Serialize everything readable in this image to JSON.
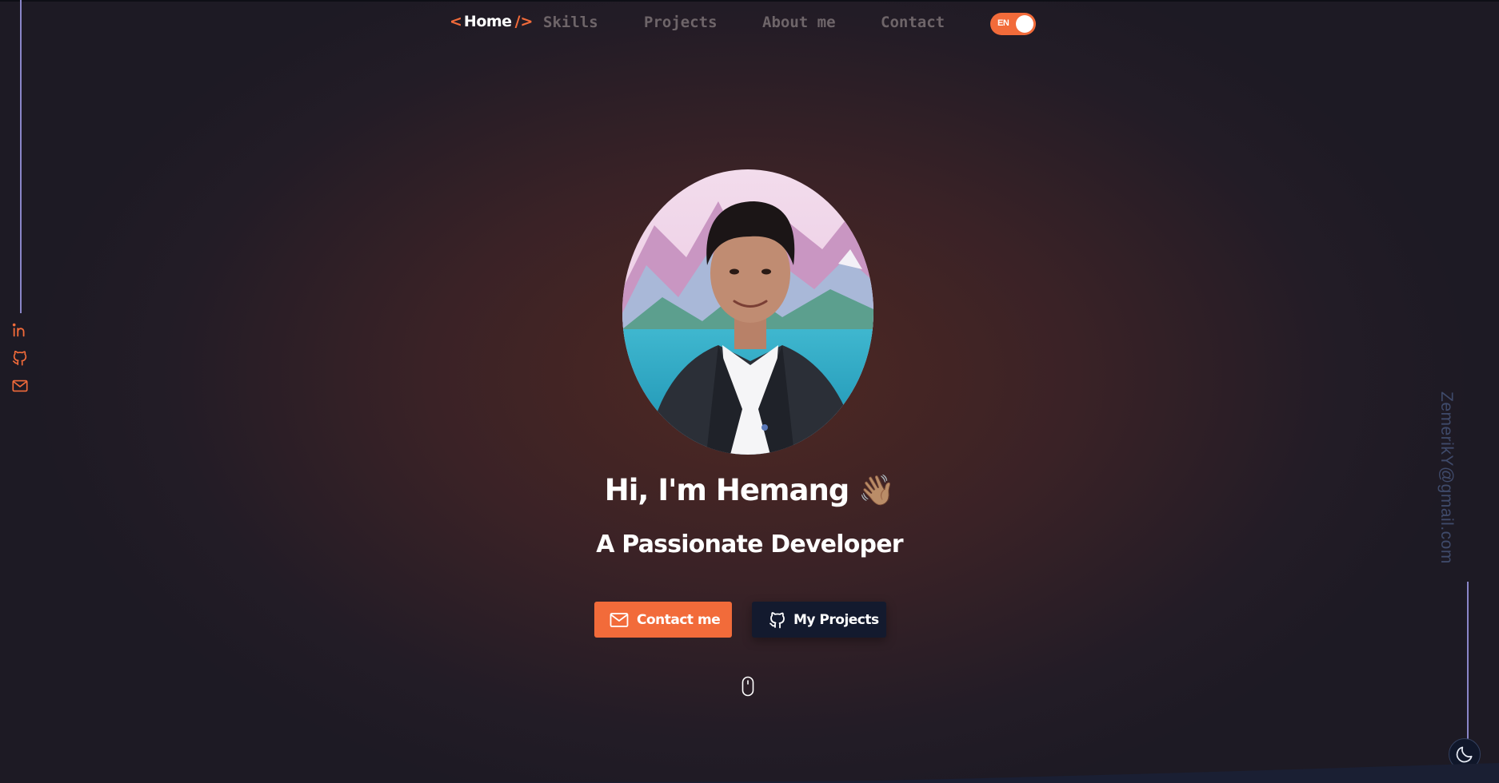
{
  "nav": {
    "home_open": "<",
    "home_label": "Home",
    "home_close": "/>",
    "links": [
      "Skills",
      "Projects",
      "About me",
      "Contact"
    ],
    "language_toggle": "EN",
    "accent_color": "#f26b3a"
  },
  "social": {
    "icons": [
      "linkedin-icon",
      "github-icon",
      "mail-icon"
    ]
  },
  "sidebar_right": {
    "email": "ZemerikY@gmail.com"
  },
  "hero": {
    "greeting": "Hi, I'm Hemang",
    "wave_emoji": "👋🏽",
    "subtitle": "A Passionate Developer",
    "contact_button": "Contact me",
    "projects_button": "My Projects"
  },
  "theme_toggle": "moon-icon",
  "scroll_indicator": "mouse-icon"
}
